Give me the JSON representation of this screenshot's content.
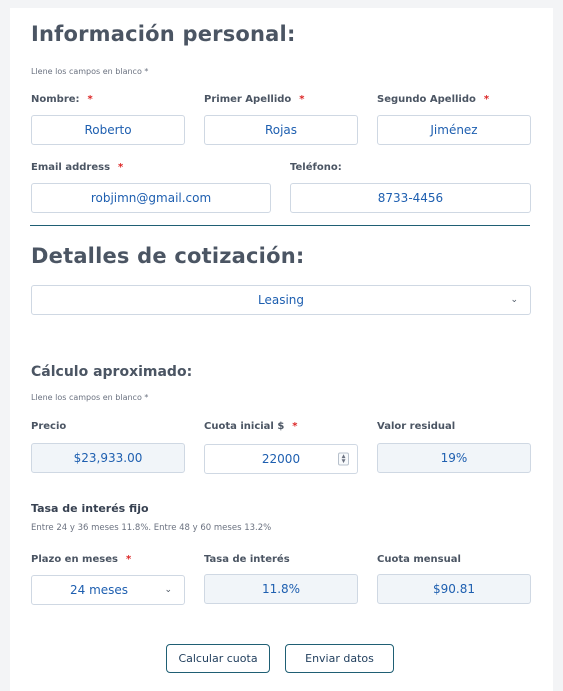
{
  "personal": {
    "title": "Información personal:",
    "hint": "Llene los campos en blanco *",
    "nombre_label": "Nombre:",
    "nombre_value": "Roberto",
    "apellido1_label": "Primer Apellido",
    "apellido1_value": "Rojas",
    "apellido2_label": "Segundo Apellido",
    "apellido2_value": "Jiménez",
    "email_label": "Email address",
    "email_value": "robjimn@gmail.com",
    "telefono_label": "Teléfono:",
    "telefono_value": "8733-4456",
    "required_mark": "*"
  },
  "cotizacion": {
    "title": "Detalles de cotización:",
    "tipo_value": "Leasing"
  },
  "calculo": {
    "title": "Cálculo aproximado:",
    "hint": "Llene los campos en blanco *",
    "precio_label": "Precio",
    "precio_value": "$23,933.00",
    "cuota_inicial_label": "Cuota inicial $",
    "cuota_inicial_value": "22000",
    "valor_residual_label": "Valor residual",
    "valor_residual_value": "19%",
    "tasa_fijo_title": "Tasa de interés fijo",
    "tasa_fijo_desc": "Entre 24 y 36 meses 11.8%. Entre 48 y 60 meses 13.2%",
    "plazo_label": "Plazo en meses",
    "plazo_value": "24 meses",
    "tasa_label": "Tasa de interés",
    "tasa_value": "11.8%",
    "cuota_mensual_label": "Cuota mensual",
    "cuota_mensual_value": "$90.81"
  },
  "actions": {
    "calcular_label": "Calcular cuota",
    "enviar_label": "Enviar datos"
  },
  "icons": {
    "chevron": "chevron-down-icon",
    "spinner": "number-spinner-icon"
  },
  "colors": {
    "accent_text": "#1e5fb0",
    "required": "#dc2626",
    "divider": "#1f5f74"
  }
}
